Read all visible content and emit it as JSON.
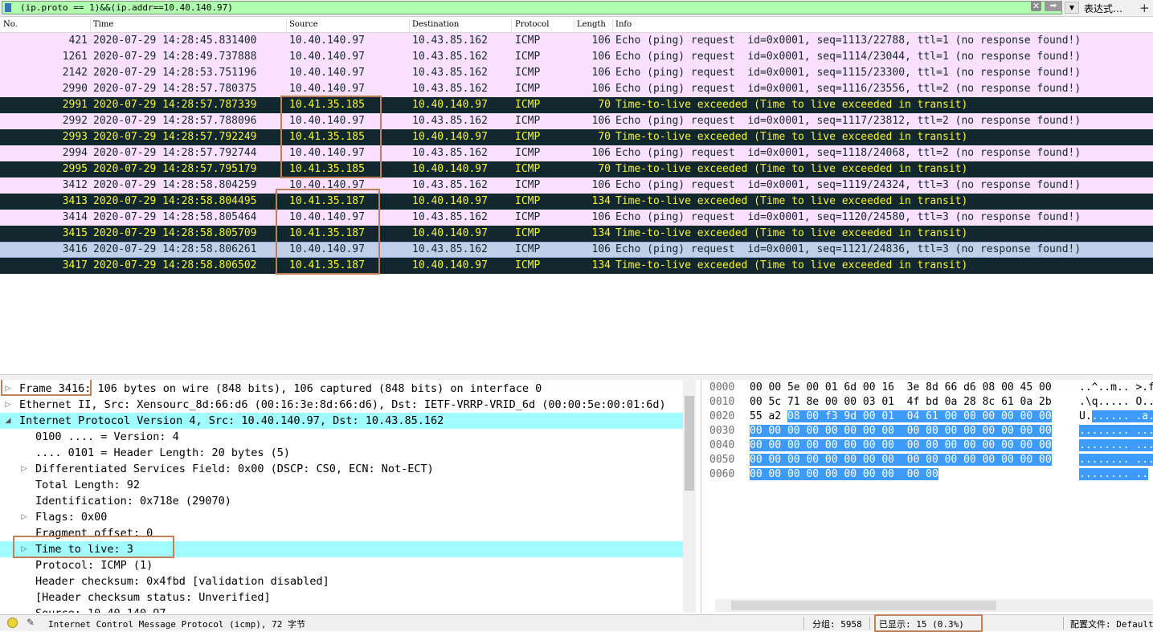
{
  "filter": {
    "value": "(ip.proto == 1)&&(ip.addr==10.40.140.97)",
    "expression_label": "表达式…",
    "add_label": "+",
    "clear_label": "✕",
    "apply_label": "➡",
    "dropdown_label": "▼"
  },
  "columns": [
    "No.",
    "Time",
    "Source",
    "Destination",
    "Protocol",
    "Length",
    "Info"
  ],
  "packets": [
    {
      "no": "421",
      "time": "2020-07-29 14:28:45.831400",
      "src": "10.40.140.97",
      "dst": "10.43.85.162",
      "proto": "ICMP",
      "len": "106",
      "info": "Echo (ping) request  id=0x0001, seq=1113/22788, ttl=1 (no response found!)",
      "kind": "request"
    },
    {
      "no": "1261",
      "time": "2020-07-29 14:28:49.737888",
      "src": "10.40.140.97",
      "dst": "10.43.85.162",
      "proto": "ICMP",
      "len": "106",
      "info": "Echo (ping) request  id=0x0001, seq=1114/23044, ttl=1 (no response found!)",
      "kind": "request"
    },
    {
      "no": "2142",
      "time": "2020-07-29 14:28:53.751196",
      "src": "10.40.140.97",
      "dst": "10.43.85.162",
      "proto": "ICMP",
      "len": "106",
      "info": "Echo (ping) request  id=0x0001, seq=1115/23300, ttl=1 (no response found!)",
      "kind": "request"
    },
    {
      "no": "2990",
      "time": "2020-07-29 14:28:57.780375",
      "src": "10.40.140.97",
      "dst": "10.43.85.162",
      "proto": "ICMP",
      "len": "106",
      "info": "Echo (ping) request  id=0x0001, seq=1116/23556, ttl=2 (no response found!)",
      "kind": "request"
    },
    {
      "no": "2991",
      "time": "2020-07-29 14:28:57.787339",
      "src": "10.41.35.185",
      "dst": "10.40.140.97",
      "proto": "ICMP",
      "len": "70",
      "info": "Time-to-live exceeded (Time to live exceeded in transit)",
      "kind": "ttl"
    },
    {
      "no": "2992",
      "time": "2020-07-29 14:28:57.788096",
      "src": "10.40.140.97",
      "dst": "10.43.85.162",
      "proto": "ICMP",
      "len": "106",
      "info": "Echo (ping) request  id=0x0001, seq=1117/23812, ttl=2 (no response found!)",
      "kind": "request"
    },
    {
      "no": "2993",
      "time": "2020-07-29 14:28:57.792249",
      "src": "10.41.35.185",
      "dst": "10.40.140.97",
      "proto": "ICMP",
      "len": "70",
      "info": "Time-to-live exceeded (Time to live exceeded in transit)",
      "kind": "ttl"
    },
    {
      "no": "2994",
      "time": "2020-07-29 14:28:57.792744",
      "src": "10.40.140.97",
      "dst": "10.43.85.162",
      "proto": "ICMP",
      "len": "106",
      "info": "Echo (ping) request  id=0x0001, seq=1118/24068, ttl=2 (no response found!)",
      "kind": "request"
    },
    {
      "no": "2995",
      "time": "2020-07-29 14:28:57.795179",
      "src": "10.41.35.185",
      "dst": "10.40.140.97",
      "proto": "ICMP",
      "len": "70",
      "info": "Time-to-live exceeded (Time to live exceeded in transit)",
      "kind": "ttl"
    },
    {
      "no": "3412",
      "time": "2020-07-29 14:28:58.804259",
      "src": "10.40.140.97",
      "dst": "10.43.85.162",
      "proto": "ICMP",
      "len": "106",
      "info": "Echo (ping) request  id=0x0001, seq=1119/24324, ttl=3 (no response found!)",
      "kind": "request"
    },
    {
      "no": "3413",
      "time": "2020-07-29 14:28:58.804495",
      "src": "10.41.35.187",
      "dst": "10.40.140.97",
      "proto": "ICMP",
      "len": "134",
      "info": "Time-to-live exceeded (Time to live exceeded in transit)",
      "kind": "ttl"
    },
    {
      "no": "3414",
      "time": "2020-07-29 14:28:58.805464",
      "src": "10.40.140.97",
      "dst": "10.43.85.162",
      "proto": "ICMP",
      "len": "106",
      "info": "Echo (ping) request  id=0x0001, seq=1120/24580, ttl=3 (no response found!)",
      "kind": "request"
    },
    {
      "no": "3415",
      "time": "2020-07-29 14:28:58.805709",
      "src": "10.41.35.187",
      "dst": "10.40.140.97",
      "proto": "ICMP",
      "len": "134",
      "info": "Time-to-live exceeded (Time to live exceeded in transit)",
      "kind": "ttl"
    },
    {
      "no": "3416",
      "time": "2020-07-29 14:28:58.806261",
      "src": "10.40.140.97",
      "dst": "10.43.85.162",
      "proto": "ICMP",
      "len": "106",
      "info": "Echo (ping) request  id=0x0001, seq=1121/24836, ttl=3 (no response found!)",
      "kind": "selected"
    },
    {
      "no": "3417",
      "time": "2020-07-29 14:28:58.806502",
      "src": "10.41.35.187",
      "dst": "10.40.140.97",
      "proto": "ICMP",
      "len": "134",
      "info": "Time-to-live exceeded (Time to live exceeded in transit)",
      "kind": "ttl"
    }
  ],
  "details": [
    {
      "text": "Frame 3416: 106 bytes on wire (848 bits), 106 captured (848 bits) on interface 0",
      "indent": 0,
      "toggle": "collapsed",
      "hl": false
    },
    {
      "text": "Ethernet II, Src: Xensourc_8d:66:d6 (00:16:3e:8d:66:d6), Dst: IETF-VRRP-VRID_6d (00:00:5e:00:01:6d)",
      "indent": 0,
      "toggle": "collapsed",
      "hl": false
    },
    {
      "text": "Internet Protocol Version 4, Src: 10.40.140.97, Dst: 10.43.85.162",
      "indent": 0,
      "toggle": "expanded",
      "hl": true
    },
    {
      "text": "0100 .... = Version: 4",
      "indent": 1,
      "toggle": "none",
      "hl": false
    },
    {
      "text": ".... 0101 = Header Length: 20 bytes (5)",
      "indent": 1,
      "toggle": "none",
      "hl": false
    },
    {
      "text": "Differentiated Services Field: 0x00 (DSCP: CS0, ECN: Not-ECT)",
      "indent": 1,
      "toggle": "collapsed",
      "hl": false
    },
    {
      "text": "Total Length: 92",
      "indent": 1,
      "toggle": "none",
      "hl": false
    },
    {
      "text": "Identification: 0x718e (29070)",
      "indent": 1,
      "toggle": "none",
      "hl": false
    },
    {
      "text": "Flags: 0x00",
      "indent": 1,
      "toggle": "collapsed",
      "hl": false
    },
    {
      "text": "Fragment offset: 0",
      "indent": 1,
      "toggle": "none",
      "hl": false
    },
    {
      "text": "Time to live: 3",
      "indent": 1,
      "toggle": "collapsed",
      "hl": true
    },
    {
      "text": "Protocol: ICMP (1)",
      "indent": 1,
      "toggle": "none",
      "hl": false
    },
    {
      "text": "Header checksum: 0x4fbd [validation disabled]",
      "indent": 1,
      "toggle": "none",
      "hl": false
    },
    {
      "text": "[Header checksum status: Unverified]",
      "indent": 1,
      "toggle": "none",
      "hl": false
    },
    {
      "text": "Source: 10.40.140.97",
      "indent": 1,
      "toggle": "none",
      "hl": false
    }
  ],
  "bytes": [
    {
      "offset": "0000",
      "hex_plain": "00 00 5e 00 01 6d 00 16  3e 8d 66 d6 08 00 45 00",
      "hex_sel": "",
      "ascii_plain": "..^..m.. >.f...E.",
      "ascii_sel": ""
    },
    {
      "offset": "0010",
      "hex_plain": "00 5c 71 8e 00 00 03 01  4f bd 0a 28 8c 61 0a 2b",
      "hex_sel": "",
      "ascii_plain": ".\\q..... O..(.a.+",
      "ascii_sel": ""
    },
    {
      "offset": "0020",
      "hex_plain": "55 a2 ",
      "hex_sel": "08 00 f3 9d 00 01  04 61 00 00 00 00 00 00",
      "ascii_plain": "U.",
      "ascii_sel": "...... .a......"
    },
    {
      "offset": "0030",
      "hex_plain": "",
      "hex_sel": "00 00 00 00 00 00 00 00  00 00 00 00 00 00 00 00",
      "ascii_plain": "",
      "ascii_sel": "........ ........"
    },
    {
      "offset": "0040",
      "hex_plain": "",
      "hex_sel": "00 00 00 00 00 00 00 00  00 00 00 00 00 00 00 00",
      "ascii_plain": "",
      "ascii_sel": "........ ........"
    },
    {
      "offset": "0050",
      "hex_plain": "",
      "hex_sel": "00 00 00 00 00 00 00 00  00 00 00 00 00 00 00 00",
      "ascii_plain": "",
      "ascii_sel": "........ ........"
    },
    {
      "offset": "0060",
      "hex_plain": "",
      "hex_sel": "00 00 00 00 00 00 00 00  00 00",
      "ascii_plain": "",
      "ascii_sel": "........ .."
    }
  ],
  "status": {
    "field_info": "Internet Control Message Protocol (icmp), 72 字节",
    "packets": "分组: 5958",
    "displayed": "已显示: 15 (0.3%)",
    "profile": "配置文件: Default"
  },
  "colors": {
    "request_bg": "#fce0ff",
    "ttl_bg": "#12272e",
    "ttl_fg": "#f7f632",
    "selected_bg": "#c2cfe8",
    "highlight_bg": "#a0fcff",
    "annotation_border": "#c0805a",
    "filter_bg": "#afffaf",
    "byte_selection": "#3d9bfd"
  }
}
